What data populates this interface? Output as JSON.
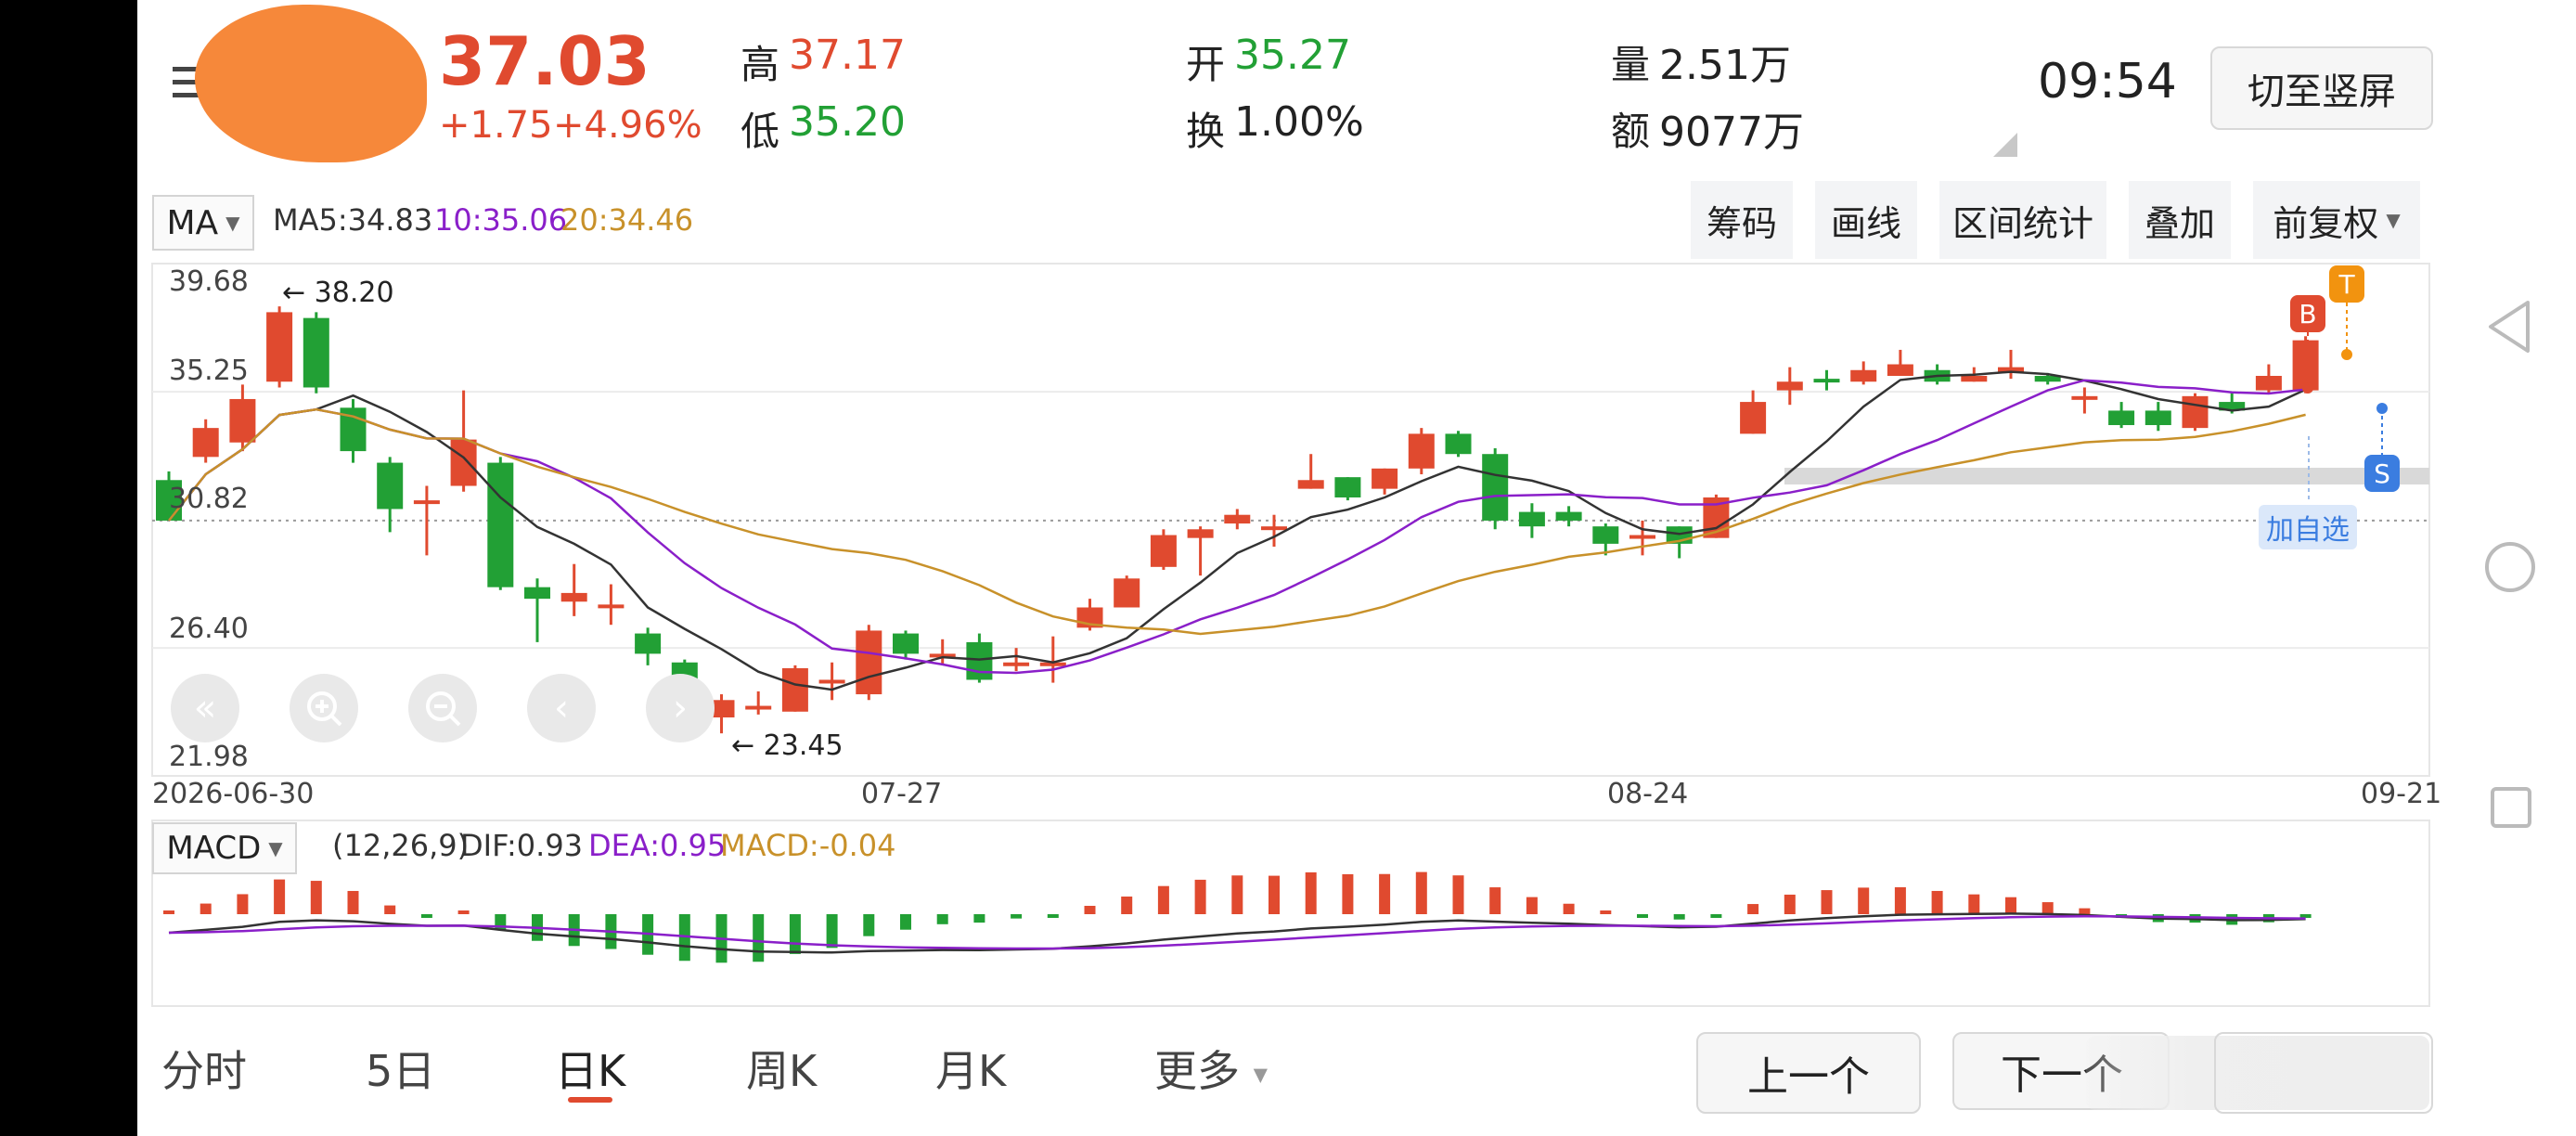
{
  "header": {
    "price": "37.03",
    "change": "+1.75",
    "change_pct": "+4.96%",
    "high_label": "高",
    "high": "37.17",
    "low_label": "低",
    "low": "35.20",
    "open_label": "开",
    "open": "35.27",
    "turnover_label": "换",
    "turnover": "1.00%",
    "volume_label": "量",
    "volume": "2.51万",
    "amount_label": "额",
    "amount": "9077万",
    "time": "09:54",
    "portrait_button": "切至竖屏"
  },
  "indicator_bar": {
    "ma_select": "MA",
    "ma5": "MA5:34.83",
    "ma10": "10:35.06",
    "ma20": "20:34.46",
    "tools": [
      "筹码",
      "画线",
      "区间统计",
      "叠加",
      "前复权"
    ]
  },
  "price_axis": [
    "39.68",
    "35.25",
    "30.82",
    "26.40",
    "21.98"
  ],
  "date_axis": [
    "2026-06-30",
    "07-27",
    "08-24",
    "09-21"
  ],
  "annotations": {
    "max_label": "← 38.20",
    "min_label": "← 23.45"
  },
  "markers": {
    "buy": "B",
    "t": "T",
    "sell": "S",
    "add_watch": "加自选"
  },
  "macd_bar": {
    "select": "MACD",
    "params": "(12,26,9)",
    "dif": "DIF:0.93",
    "dea": "DEA:0.95",
    "macd": "MACD:-0.04"
  },
  "bottom_tabs": [
    "分时",
    "5日",
    "日K",
    "周K",
    "月K",
    "更多"
  ],
  "active_tab": "日K",
  "nav": {
    "prev": "上一个",
    "next": "下一个"
  },
  "colors": {
    "up": "#e04a2f",
    "down": "#22a035",
    "ma5": "#333333",
    "ma10": "#8a1fc9",
    "ma20": "#c8912a",
    "accent": "#e04a2f"
  },
  "chart_data": {
    "type": "candlestick",
    "ylim": [
      21.98,
      39.68
    ],
    "candles": [
      [
        32.2,
        30.8,
        32.5,
        30.8
      ],
      [
        33.0,
        34.0,
        34.3,
        32.8
      ],
      [
        33.5,
        35.0,
        35.5,
        33.2
      ],
      [
        35.6,
        38.0,
        38.2,
        35.4
      ],
      [
        37.8,
        35.4,
        38.0,
        35.2
      ],
      [
        34.7,
        33.2,
        35.0,
        32.8
      ],
      [
        32.8,
        31.2,
        33.0,
        30.4
      ],
      [
        31.5,
        31.5,
        32.0,
        29.6
      ],
      [
        32.0,
        33.6,
        35.3,
        31.8
      ],
      [
        32.8,
        28.5,
        33.0,
        28.4
      ],
      [
        28.5,
        28.1,
        28.8,
        26.6
      ],
      [
        28.0,
        28.3,
        29.3,
        27.5
      ],
      [
        27.9,
        27.9,
        28.6,
        27.2
      ],
      [
        26.9,
        26.2,
        27.1,
        25.8
      ],
      [
        25.9,
        24.8,
        26.0,
        24.4
      ],
      [
        24.0,
        24.6,
        24.8,
        23.45
      ],
      [
        24.4,
        24.4,
        24.9,
        24.1
      ],
      [
        24.2,
        25.7,
        25.8,
        24.2
      ],
      [
        25.3,
        25.3,
        25.9,
        24.6
      ],
      [
        24.8,
        27.0,
        27.2,
        24.6
      ],
      [
        26.9,
        26.2,
        27.0,
        26.0
      ],
      [
        26.2,
        26.2,
        26.7,
        25.8
      ],
      [
        26.6,
        25.3,
        26.9,
        25.2
      ],
      [
        25.9,
        25.9,
        26.4,
        25.6
      ],
      [
        25.9,
        25.9,
        26.8,
        25.2
      ],
      [
        27.1,
        27.8,
        28.1,
        27.0
      ],
      [
        27.8,
        28.8,
        28.9,
        27.8
      ],
      [
        29.2,
        30.3,
        30.5,
        29.1
      ],
      [
        30.2,
        30.5,
        30.6,
        28.9
      ],
      [
        30.7,
        31.0,
        31.2,
        30.5
      ],
      [
        30.6,
        30.6,
        31.0,
        29.9
      ],
      [
        31.9,
        32.2,
        33.1,
        31.9
      ],
      [
        32.3,
        31.6,
        32.3,
        31.5
      ],
      [
        31.9,
        32.6,
        32.6,
        31.7
      ],
      [
        32.6,
        33.8,
        34.0,
        32.4
      ],
      [
        33.8,
        33.1,
        33.9,
        33.0
      ],
      [
        33.1,
        30.8,
        33.3,
        30.5
      ],
      [
        31.1,
        30.6,
        31.4,
        30.2
      ],
      [
        31.1,
        30.8,
        31.3,
        30.6
      ],
      [
        30.6,
        30.0,
        30.7,
        29.6
      ],
      [
        30.2,
        30.3,
        30.8,
        29.6
      ],
      [
        30.6,
        30.0,
        30.6,
        29.5
      ],
      [
        30.2,
        31.6,
        31.7,
        30.2
      ],
      [
        33.8,
        34.9,
        35.3,
        33.8
      ],
      [
        35.3,
        35.6,
        36.1,
        34.8
      ],
      [
        35.7,
        35.6,
        36.0,
        35.3
      ],
      [
        35.6,
        36.0,
        36.3,
        35.5
      ],
      [
        35.8,
        36.2,
        36.7,
        35.8
      ],
      [
        36.0,
        35.6,
        36.2,
        35.5
      ],
      [
        35.6,
        35.8,
        36.1,
        35.6
      ],
      [
        35.9,
        36.1,
        36.7,
        35.7
      ],
      [
        35.8,
        35.6,
        35.9,
        35.5
      ],
      [
        35.0,
        35.1,
        35.4,
        34.5
      ],
      [
        34.6,
        34.1,
        34.9,
        34.0
      ],
      [
        34.6,
        34.1,
        34.9,
        33.9
      ],
      [
        34.0,
        35.1,
        35.2,
        33.9
      ],
      [
        34.9,
        34.6,
        35.2,
        34.5
      ],
      [
        35.3,
        35.8,
        36.2,
        35.2
      ],
      [
        35.3,
        37.03,
        37.17,
        35.2
      ]
    ]
  }
}
